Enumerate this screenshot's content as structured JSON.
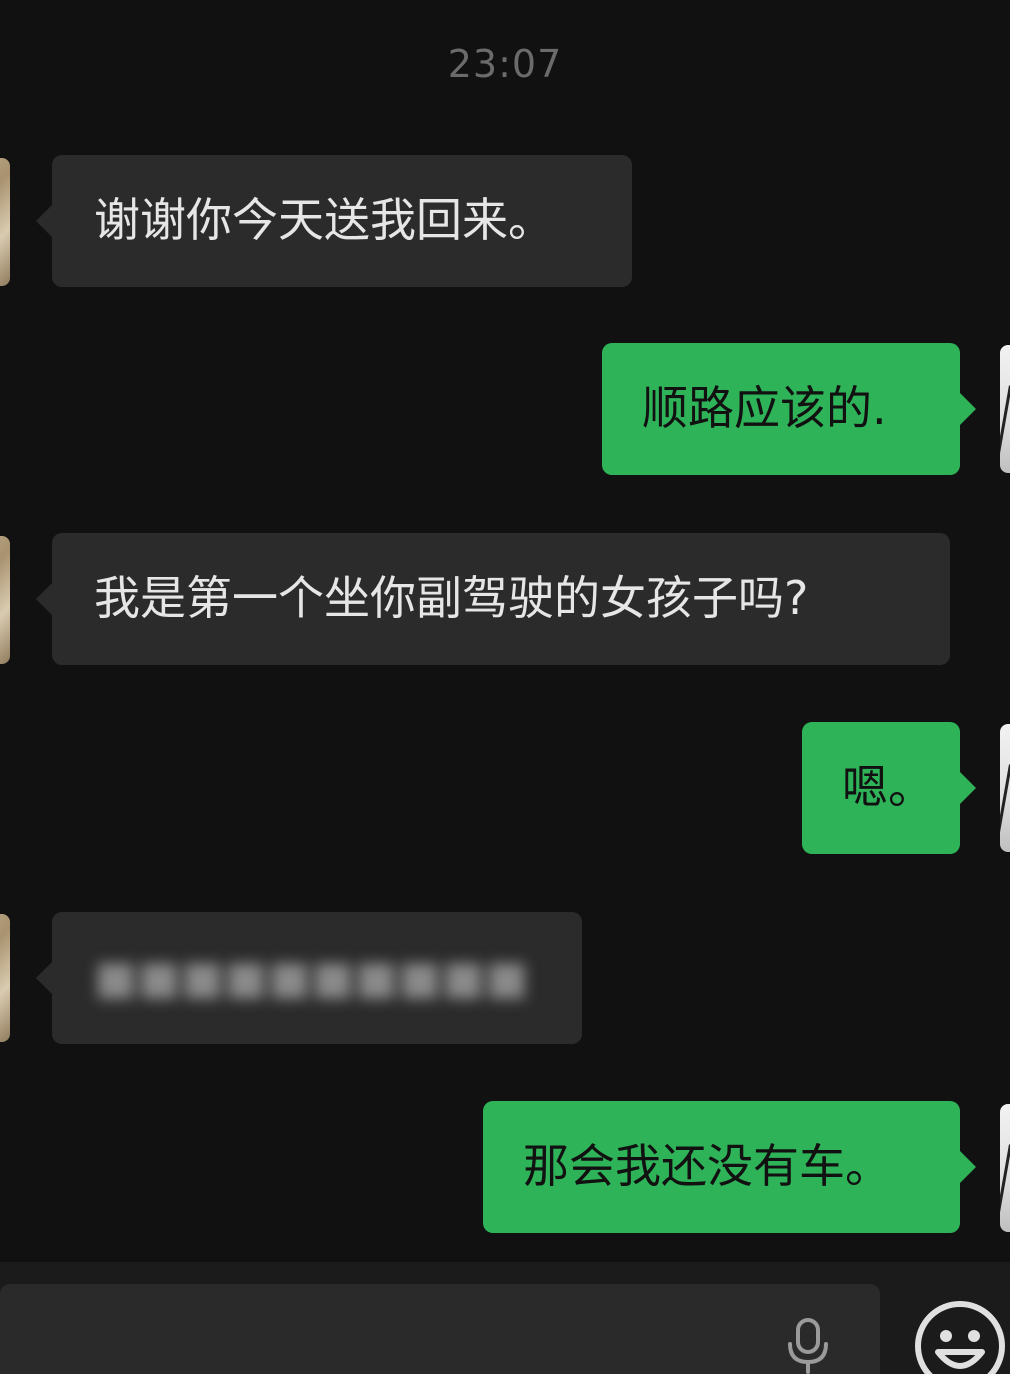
{
  "timestamp": "23:07",
  "messages": [
    {
      "side": "in",
      "text": "谢谢你今天送我回来。"
    },
    {
      "side": "out",
      "text": "顺路应该的."
    },
    {
      "side": "in",
      "text": "我是第一个坐你副驾驶的女孩子吗?"
    },
    {
      "side": "out",
      "text": "嗯。"
    },
    {
      "side": "in",
      "text": "",
      "blurred": true
    },
    {
      "side": "out",
      "text": "那会我还没有车。"
    }
  ],
  "input": {
    "value": "",
    "placeholder": ""
  },
  "icons": {
    "voice": "microphone-icon",
    "emoji": "emoji-smile-icon"
  },
  "colors": {
    "background": "#111111",
    "incoming_bubble": "#2b2b2b",
    "outgoing_bubble": "#2fb359"
  }
}
